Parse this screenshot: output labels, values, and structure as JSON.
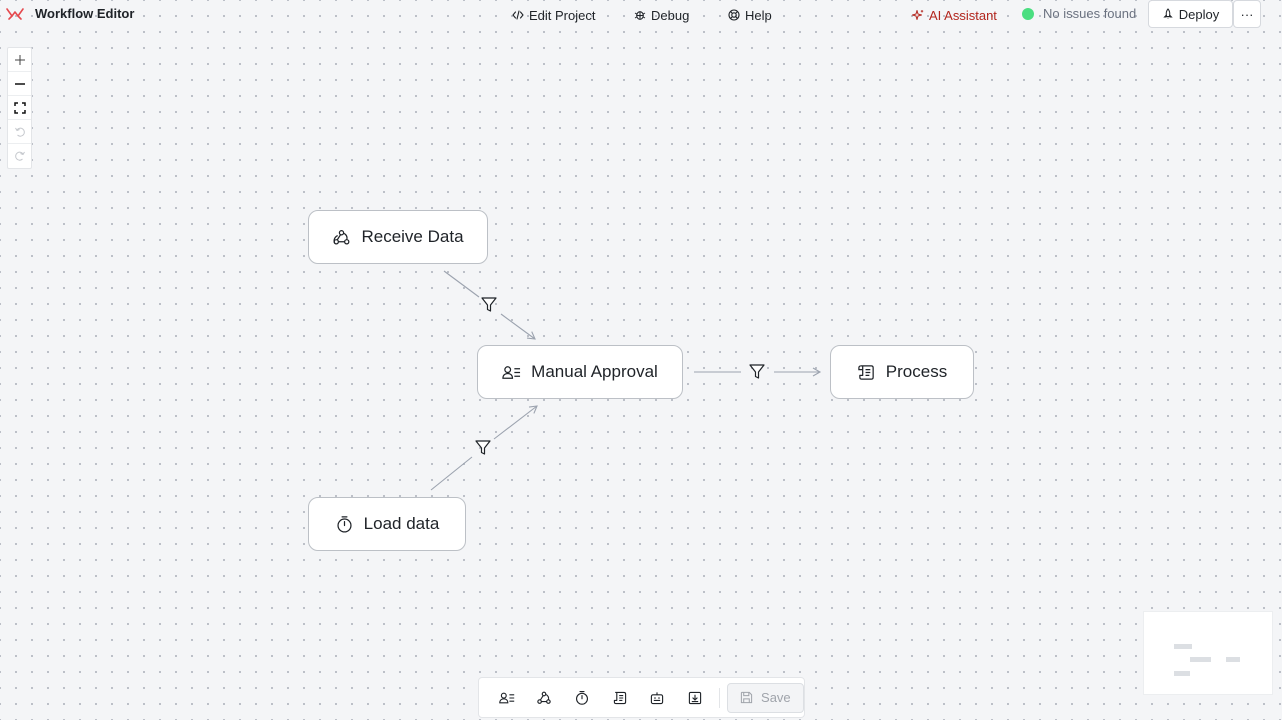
{
  "app": {
    "title": "Workflow Editor"
  },
  "nav": {
    "edit_project": "Edit Project",
    "debug": "Debug",
    "help": "Help",
    "ai_assistant": "AI Assistant"
  },
  "status": {
    "text": "No issues found",
    "color": "#4ade80"
  },
  "actions": {
    "deploy": "Deploy",
    "more": "···"
  },
  "nodes": [
    {
      "label": "Receive Data",
      "icon": "webhook-icon"
    },
    {
      "label": "Manual Approval",
      "icon": "user-list-icon"
    },
    {
      "label": "Process",
      "icon": "script-icon"
    },
    {
      "label": "Load data",
      "icon": "timer-icon"
    }
  ],
  "toolbar": {
    "save_label": "Save"
  },
  "colors": {
    "accent": "#b3261e",
    "logo": "#e5484d",
    "edge": "#9ca3af"
  }
}
